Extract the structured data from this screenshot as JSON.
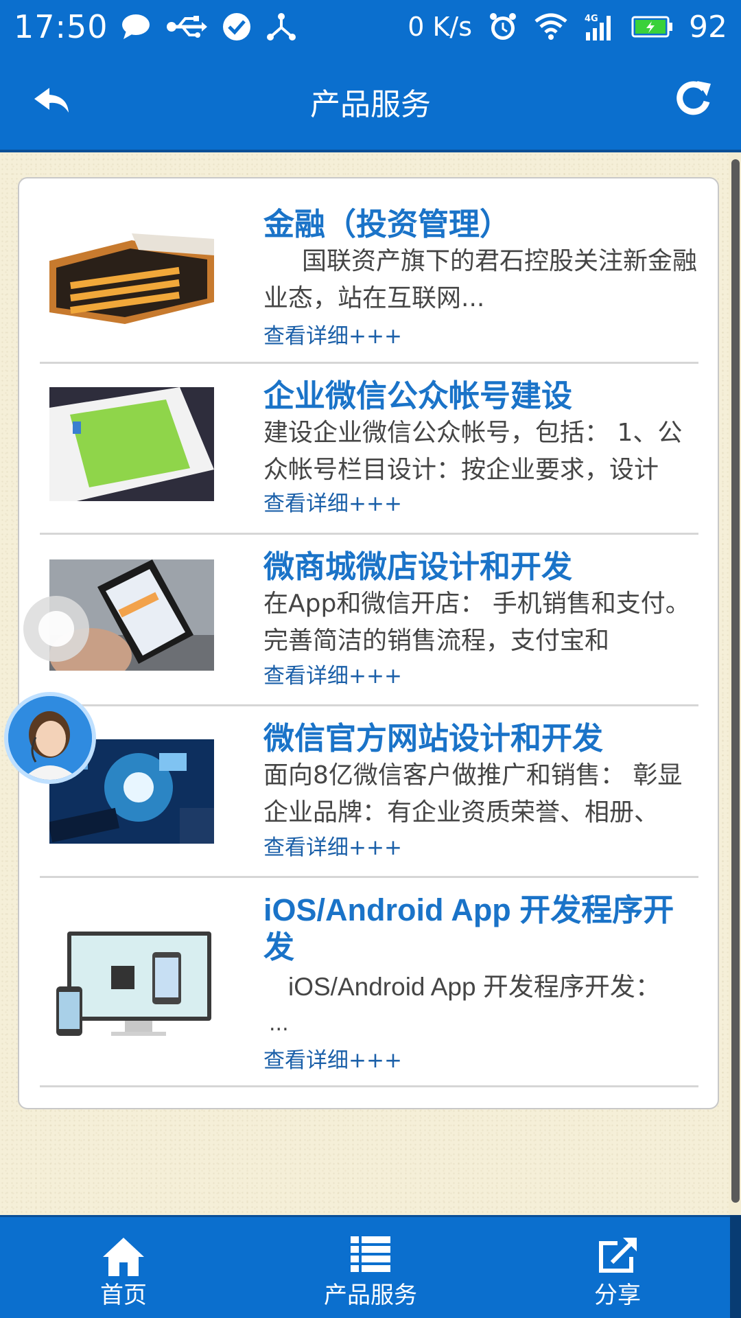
{
  "status_bar": {
    "time": "17:50",
    "speed": "0 K/s",
    "battery": "92",
    "left_icons": [
      "chat-bubble-icon",
      "usb-icon",
      "check-circle-icon",
      "share-node-icon"
    ],
    "right_icons": [
      "alarm-icon",
      "wifi-icon",
      "signal-4g-icon",
      "battery-icon"
    ]
  },
  "header": {
    "title": "产品服务"
  },
  "products": [
    {
      "title": "金融（投资管理）",
      "desc": "国联资产旗下的君石控股关注新金融业态，站在互联网...",
      "more": "查看详细+++"
    },
    {
      "title": "企业微信公众帐号建设",
      "desc": "建设企业微信公众帐号，包括： 1、公众帐号栏目设计：按企业要求，设计",
      "more": "查看详细+++"
    },
    {
      "title": "微商城微店设计和开发",
      "desc": "在App和微信开店： 手机销售和支付。完善简洁的销售流程，支付宝和",
      "more": "查看详细+++"
    },
    {
      "title": "微信官方网站设计和开发",
      "desc": "面向8亿微信客户做推广和销售： 彰显企业品牌：有企业资质荣誉、相册、",
      "more": "查看详细+++"
    },
    {
      "title": "iOS/Android App 开发程序开发",
      "desc": "iOS/Android App 开发程序开发：",
      "desc2": "...",
      "more": "查看详细+++"
    }
  ],
  "bottom_nav": {
    "items": [
      {
        "label": "首页",
        "icon": "home-icon"
      },
      {
        "label": "产品服务",
        "icon": "list-icon"
      },
      {
        "label": "分享",
        "icon": "share-icon"
      }
    ]
  },
  "colors": {
    "primary": "#0b6fce",
    "link": "#1a73c8",
    "background": "#f5efd8"
  }
}
